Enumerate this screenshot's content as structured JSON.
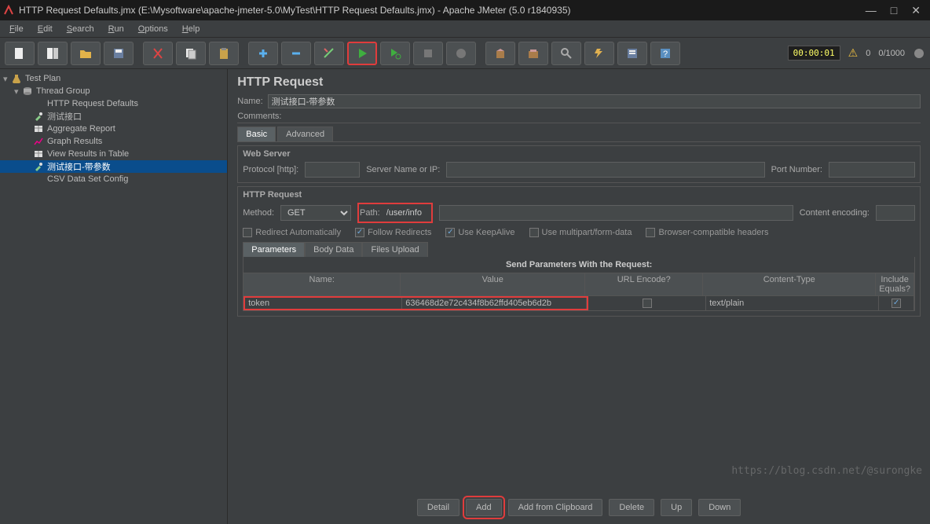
{
  "window": {
    "title": "HTTP Request Defaults.jmx (E:\\Mysoftware\\apache-jmeter-5.0\\MyTest\\HTTP Request Defaults.jmx) - Apache JMeter (5.0 r1840935)"
  },
  "menu": {
    "file": "File",
    "edit": "Edit",
    "search": "Search",
    "run": "Run",
    "options": "Options",
    "help": "Help"
  },
  "tree": {
    "items": [
      {
        "label": "Test Plan",
        "indent": 0,
        "icon": "flask",
        "caret": "▾"
      },
      {
        "label": "Thread Group",
        "indent": 1,
        "icon": "spool",
        "caret": "▾"
      },
      {
        "label": "HTTP Request Defaults",
        "indent": 2,
        "icon": "wrench"
      },
      {
        "label": "测试接口",
        "indent": 2,
        "icon": "dropper"
      },
      {
        "label": "Aggregate Report",
        "indent": 2,
        "icon": "table"
      },
      {
        "label": "Graph Results",
        "indent": 2,
        "icon": "graph"
      },
      {
        "label": "View Results in Table",
        "indent": 2,
        "icon": "table"
      },
      {
        "label": "测试接口-带参数",
        "indent": 2,
        "icon": "dropper",
        "selected": true
      },
      {
        "label": "CSV Data Set Config",
        "indent": 2,
        "icon": "wrench"
      }
    ]
  },
  "panel": {
    "heading": "HTTP Request",
    "name_label": "Name:",
    "name_value": "测试接口-带参数",
    "comments_label": "Comments:",
    "tabs": {
      "basic": "Basic",
      "advanced": "Advanced"
    },
    "web_server": {
      "legend": "Web Server",
      "protocol_label": "Protocol [http]:",
      "server_label": "Server Name or IP:",
      "port_label": "Port Number:"
    },
    "http_request": {
      "legend": "HTTP Request",
      "method_label": "Method:",
      "method_value": "GET",
      "path_label": "Path:",
      "path_value": "/user/info",
      "enc_label": "Content encoding:"
    },
    "checks": {
      "redirect_auto": "Redirect Automatically",
      "follow": "Follow Redirects",
      "keepalive": "Use KeepAlive",
      "multipart": "Use multipart/form-data",
      "browser": "Browser-compatible headers"
    },
    "subtabs": {
      "params": "Parameters",
      "body": "Body Data",
      "files": "Files Upload"
    },
    "param_section_title": "Send Parameters With the Request:",
    "columns": {
      "name": "Name:",
      "value": "Value",
      "enc": "URL Encode?",
      "ct": "Content-Type",
      "eq": "Include Equals?"
    },
    "rows": [
      {
        "name": "token",
        "value": "636468d2e72c434f8b62ffd405eb6d2b",
        "enc": false,
        "ct": "text/plain",
        "eq": true
      }
    ]
  },
  "buttons": {
    "detail": "Detail",
    "add": "Add",
    "clip": "Add from Clipboard",
    "delete": "Delete",
    "up": "Up",
    "down": "Down"
  },
  "status": {
    "timer": "00:00:01",
    "warn": "0",
    "ratio": "0/1000"
  },
  "watermark": "https://blog.csdn.net/@surongke"
}
